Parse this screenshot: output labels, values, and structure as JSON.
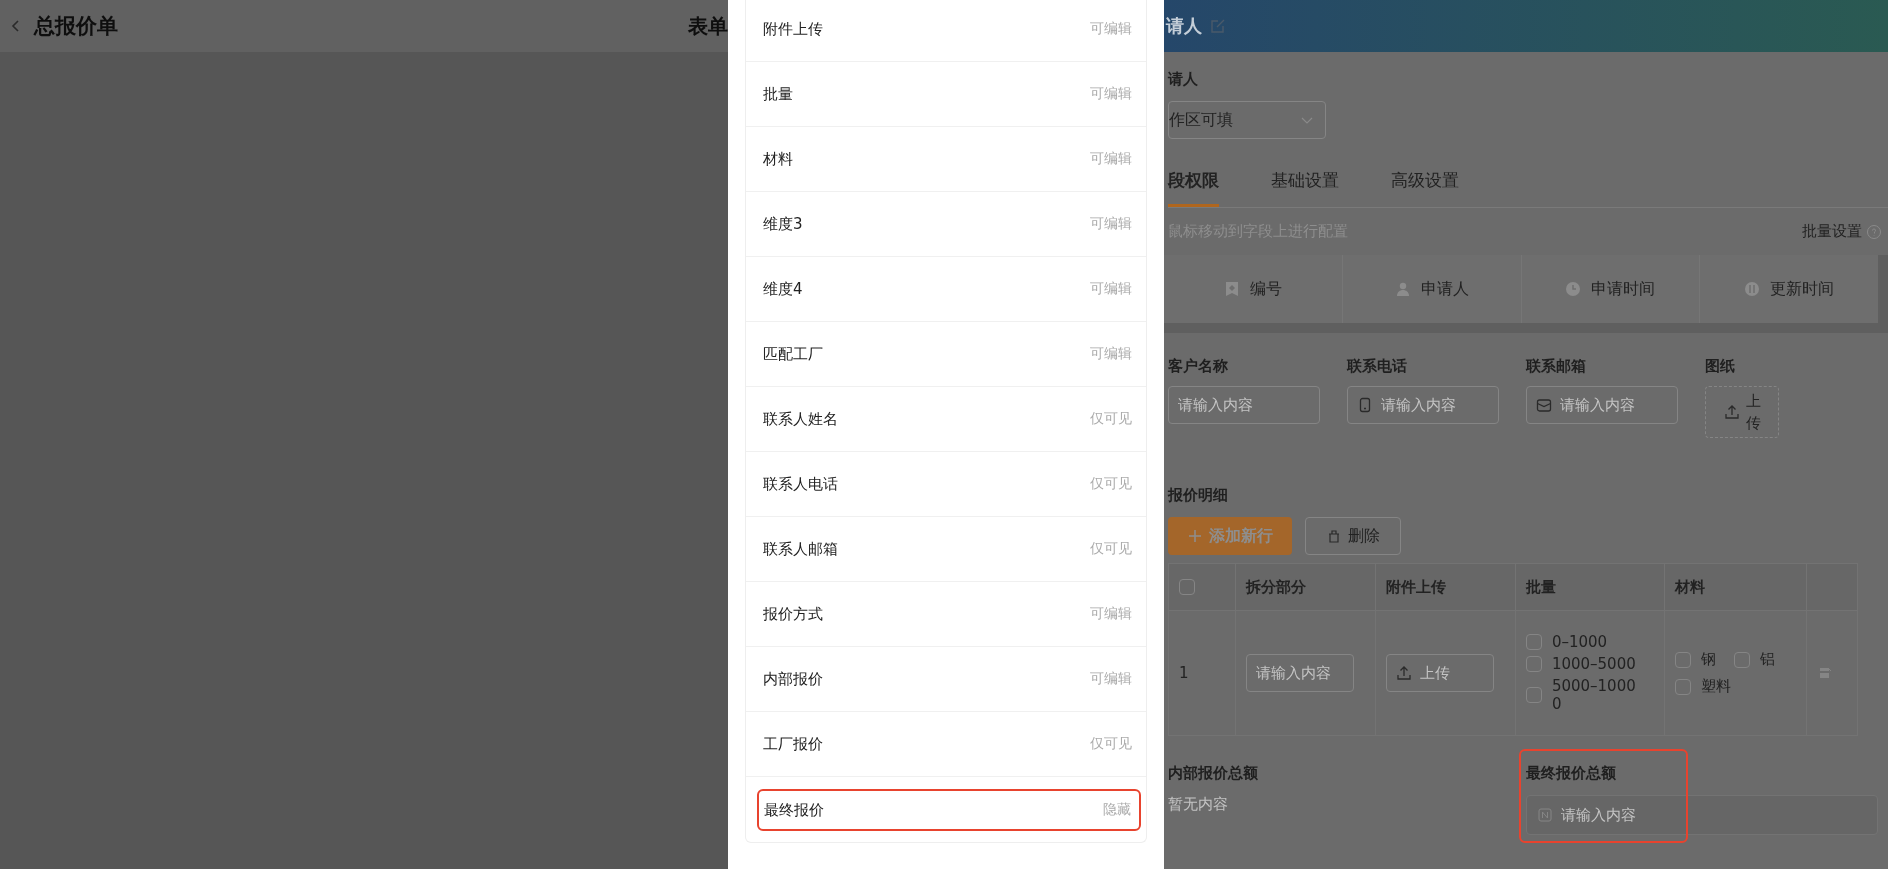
{
  "background": {
    "title": "总报价单",
    "center_title": "表单"
  },
  "sheet": {
    "rows": [
      {
        "name": "附件上传",
        "permission": "可编辑",
        "highlighted": false
      },
      {
        "name": "批量",
        "permission": "可编辑",
        "highlighted": false
      },
      {
        "name": "材料",
        "permission": "可编辑",
        "highlighted": false
      },
      {
        "name": "维度3",
        "permission": "可编辑",
        "highlighted": false
      },
      {
        "name": "维度4",
        "permission": "可编辑",
        "highlighted": false
      },
      {
        "name": "匹配工厂",
        "permission": "可编辑",
        "highlighted": false
      },
      {
        "name": "联系人姓名",
        "permission": "仅可见",
        "highlighted": false
      },
      {
        "name": "联系人电话",
        "permission": "仅可见",
        "highlighted": false
      },
      {
        "name": "联系人邮箱",
        "permission": "仅可见",
        "highlighted": false
      },
      {
        "name": "报价方式",
        "permission": "可编辑",
        "highlighted": false
      },
      {
        "name": "内部报价",
        "permission": "可编辑",
        "highlighted": false
      },
      {
        "name": "工厂报价",
        "permission": "仅可见",
        "highlighted": false
      },
      {
        "name": "最终报价",
        "permission": "隐藏",
        "highlighted": true
      }
    ]
  },
  "editor": {
    "header_title": "请人",
    "applicant_label": "请人",
    "applicant_select": "作区可填",
    "tabs": [
      {
        "label": "段权限",
        "selected": true
      },
      {
        "label": "基础设置",
        "selected": false
      },
      {
        "label": "高级设置",
        "selected": false
      }
    ],
    "hint": "鼠标移动到字段上进行配置",
    "batch_link": "批量设置",
    "system_fields": [
      {
        "label": "编号"
      },
      {
        "label": "申请人"
      },
      {
        "label": "申请时间"
      },
      {
        "label": "更新时间"
      }
    ],
    "form_fields": [
      {
        "label": "客户名称",
        "kind": "input",
        "placeholder": "请输入内容"
      },
      {
        "label": "联系电话",
        "kind": "input",
        "placeholder": "请输入内容"
      },
      {
        "label": "联系邮箱",
        "kind": "input",
        "placeholder": "请输入内容"
      },
      {
        "label": "图纸",
        "kind": "upload",
        "upload": "上传"
      }
    ],
    "detail": {
      "title": "报价明细",
      "add_button": "添加新行",
      "delete_button": "删除",
      "select_all_checked": false,
      "columns": [
        "拆分部分",
        "附件上传",
        "批量",
        "材料"
      ],
      "rows": [
        {
          "index": "1",
          "part_placeholder": "请输入内容",
          "upload": "上传",
          "batch_options": [
            {
              "label": "0–1000",
              "checked": false
            },
            {
              "label": "1000–5000",
              "checked": false
            },
            {
              "label": "5000–10000",
              "checked": false
            }
          ],
          "materials": [
            {
              "label": "钢",
              "checked": false
            },
            {
              "label": "铝",
              "checked": false
            },
            {
              "label": "塑料",
              "checked": false
            }
          ]
        }
      ]
    },
    "totals": [
      {
        "label": "内部报价总额",
        "kind": "empty",
        "text": "暂无内容",
        "highlighted": false
      },
      {
        "label": "最终报价总额",
        "kind": "input",
        "placeholder": "请输入内容",
        "highlighted": true
      }
    ]
  }
}
